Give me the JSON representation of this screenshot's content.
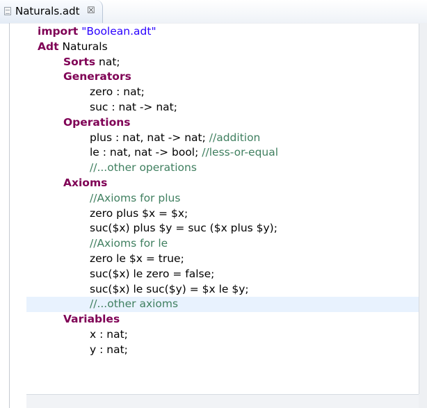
{
  "tab": {
    "title": "Naturals.adt",
    "close_glyph": "☒"
  },
  "colors": {
    "keyword": "#7f0055",
    "string": "#2a00ff",
    "comment": "#3f7f5f",
    "current_line_highlight": "#e8f2fe"
  },
  "icons": {
    "tab_icon": "file-icon",
    "close_icon": "close-icon"
  },
  "code": {
    "l1": {
      "keyword": "import",
      "string": "\"Boolean.adt\""
    },
    "l2": {
      "keyword": "Adt",
      "text": " Naturals"
    },
    "l3": {
      "keyword": "Sorts",
      "text": " nat;"
    },
    "l4": {
      "keyword": "Generators"
    },
    "l5": {
      "text": "zero : nat;"
    },
    "l6": {
      "text": "suc : nat -> nat;"
    },
    "l7": {
      "keyword": "Operations"
    },
    "l8": {
      "text": "plus : nat, nat -> nat; ",
      "comment": "//addition"
    },
    "l9": {
      "text": "le : nat, nat -> bool; ",
      "comment": "//less-or-equal"
    },
    "l10": {
      "comment": "//...other operations"
    },
    "l11": {
      "keyword": "Axioms"
    },
    "l12": {
      "comment": "//Axioms for plus"
    },
    "l13": {
      "text": "zero plus $x = $x;"
    },
    "l14": {
      "text": "suc($x) plus $y = suc ($x plus $y);"
    },
    "l15": {
      "comment": "//Axioms for le"
    },
    "l16": {
      "text": "zero le $x = true;"
    },
    "l17": {
      "text": "suc($x) le zero = false;"
    },
    "l18": {
      "text": "suc($x) le suc($y) = $x le $y;"
    },
    "l19": {
      "comment": "//...other axioms"
    },
    "l20": {
      "keyword": "Variables"
    },
    "l21": {
      "text": "x : nat;"
    },
    "l22": {
      "text": "y : nat;"
    }
  }
}
